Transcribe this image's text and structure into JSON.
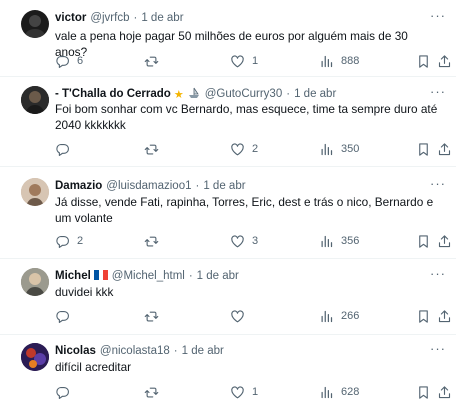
{
  "tweets": [
    {
      "name": "victor",
      "handle": "@jvrfcb",
      "dot": "·",
      "date": "1 de abr",
      "text": "vale a pena hoje pagar 50 milhões de euros por alguém mais de 30 anos?",
      "replies": "6",
      "retweets": "",
      "likes": "1",
      "views": "888"
    },
    {
      "name": "- T'Challa do Cerrado",
      "handle": "@GutoCurry30",
      "dot": "·",
      "date": "1 de abr",
      "text": "Foi bom sonhar com vc Bernardo, mas esquece, time ta sempre duro até 2040 kkkkkkk",
      "replies": "",
      "retweets": "",
      "likes": "2",
      "views": "350"
    },
    {
      "name": "Damazio",
      "handle": "@luisdamazioo1",
      "dot": "·",
      "date": "1 de abr",
      "text": "Já disse, vende Fati, rapinha, Torres, Eric, dest e trás o nico, Bernardo e um volante",
      "replies": "2",
      "retweets": "",
      "likes": "3",
      "views": "356"
    },
    {
      "name": "Michel",
      "handle": "@Michel_html",
      "dot": "·",
      "date": "1 de abr",
      "text": "duvidei kkk",
      "replies": "",
      "retweets": "",
      "likes": "",
      "views": "266"
    },
    {
      "name": "Nicolas",
      "handle": "@nicolasta18",
      "dot": "·",
      "date": "1 de abr",
      "text": "difícil acreditar",
      "replies": "",
      "retweets": "",
      "likes": "1",
      "views": "628"
    }
  ],
  "icons": {
    "more": "more-icon",
    "reply": "reply-icon",
    "retweet": "retweet-icon",
    "like": "heart-icon",
    "views": "views-icon",
    "bookmark": "bookmark-icon",
    "share": "share-icon",
    "badge_star": "star-badge-icon",
    "badge_boat": "boat-badge-icon",
    "flag": "france-flag-icon"
  },
  "colors": {
    "text": "#0f1419",
    "secondary": "#536471",
    "divider": "#eff3f4",
    "star": "#f4b400",
    "flag_blue": "#0055a4",
    "flag_red": "#ef4135"
  }
}
